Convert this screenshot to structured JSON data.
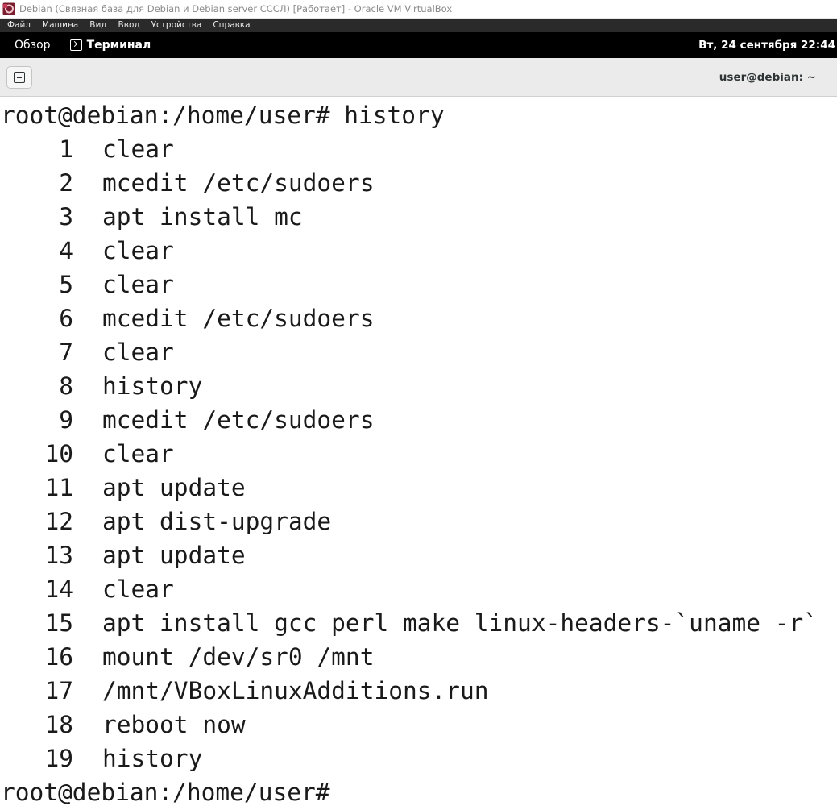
{
  "vbox": {
    "title": "Debian (Связная база для Debian и Debian server СССЛ) [Работает] - Oracle VM VirtualBox",
    "menu": [
      "Файл",
      "Машина",
      "Вид",
      "Ввод",
      "Устройства",
      "Справка"
    ]
  },
  "gnome": {
    "overview": "Обзор",
    "app_name": "Терминал",
    "clock": "Вт, 24 сентября  22:44"
  },
  "terminal": {
    "window_title": "user@debian: ~",
    "prompt_line": "root@debian:/home/user# history",
    "history": [
      {
        "n": "1",
        "cmd": "clear"
      },
      {
        "n": "2",
        "cmd": "mcedit /etc/sudoers"
      },
      {
        "n": "3",
        "cmd": "apt install mc"
      },
      {
        "n": "4",
        "cmd": "clear"
      },
      {
        "n": "5",
        "cmd": "clear"
      },
      {
        "n": "6",
        "cmd": "mcedit /etc/sudoers"
      },
      {
        "n": "7",
        "cmd": "clear"
      },
      {
        "n": "8",
        "cmd": "history"
      },
      {
        "n": "9",
        "cmd": "mcedit /etc/sudoers"
      },
      {
        "n": "10",
        "cmd": "clear"
      },
      {
        "n": "11",
        "cmd": "apt update"
      },
      {
        "n": "12",
        "cmd": "apt dist-upgrade"
      },
      {
        "n": "13",
        "cmd": "apt update"
      },
      {
        "n": "14",
        "cmd": "clear"
      },
      {
        "n": "15",
        "cmd": "apt install gcc perl make linux-headers-`uname -r`"
      },
      {
        "n": "16",
        "cmd": "mount /dev/sr0 /mnt"
      },
      {
        "n": "17",
        "cmd": "/mnt/VBoxLinuxAdditions.run"
      },
      {
        "n": "18",
        "cmd": "reboot now"
      },
      {
        "n": "19",
        "cmd": "history"
      }
    ],
    "final_prompt": "root@debian:/home/user# "
  }
}
